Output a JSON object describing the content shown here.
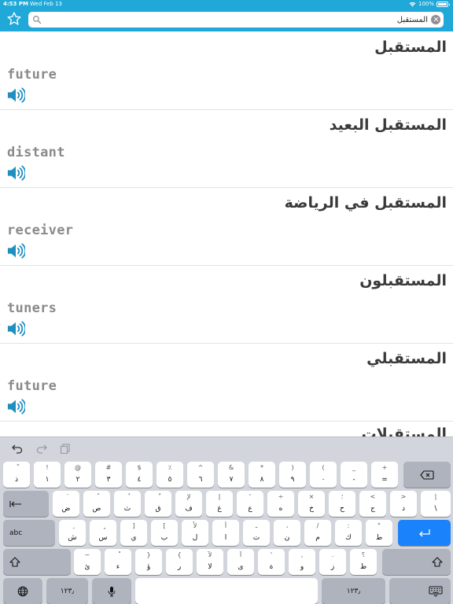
{
  "status": {
    "time": "4:53 PM",
    "date": "Wed Feb 13",
    "battery": "100%"
  },
  "search": {
    "query": "المستقبل",
    "placeholder": ""
  },
  "results": [
    {
      "arabic": "المستقبل",
      "english": "future"
    },
    {
      "arabic": "المستقبل البعيد",
      "english": "distant"
    },
    {
      "arabic": "المستقبل في الرياضة",
      "english": "receiver"
    },
    {
      "arabic": "المستقبلون",
      "english": "tuners"
    },
    {
      "arabic": "المستقبلي",
      "english": "future"
    },
    {
      "arabic": "المستقبلات",
      "english": ""
    }
  ],
  "keyboard": {
    "row1": [
      {
        "sub": "ّ",
        "main": "ذ"
      },
      {
        "sub": "!",
        "main": "١"
      },
      {
        "sub": "@",
        "main": "٢"
      },
      {
        "sub": "#",
        "main": "٣"
      },
      {
        "sub": "$",
        "main": "٤"
      },
      {
        "sub": "٪",
        "main": "٥"
      },
      {
        "sub": "^",
        "main": "٦"
      },
      {
        "sub": "&",
        "main": "٧"
      },
      {
        "sub": "*",
        "main": "٨"
      },
      {
        "sub": ")",
        "main": "٩"
      },
      {
        "sub": "(",
        "main": "٠"
      },
      {
        "sub": "_",
        "main": "-"
      },
      {
        "sub": "+",
        "main": "="
      }
    ],
    "row2": [
      {
        "sub": "َ",
        "main": "ض"
      },
      {
        "sub": "ً",
        "main": "ص"
      },
      {
        "sub": "ُ",
        "main": "ث"
      },
      {
        "sub": "ٌ",
        "main": "ق"
      },
      {
        "sub": "لإ",
        "main": "ف"
      },
      {
        "sub": "إ",
        "main": "غ"
      },
      {
        "sub": "‘",
        "main": "ع"
      },
      {
        "sub": "÷",
        "main": "ه"
      },
      {
        "sub": "×",
        "main": "خ"
      },
      {
        "sub": "؛",
        "main": "ح"
      },
      {
        "sub": "<",
        "main": "ج"
      },
      {
        "sub": ">",
        "main": "د"
      },
      {
        "sub": "|",
        "main": "\\"
      }
    ],
    "row3": [
      {
        "sub": "ِ",
        "main": "ش"
      },
      {
        "sub": "ٍ",
        "main": "س"
      },
      {
        "sub": "]",
        "main": "ي"
      },
      {
        "sub": "[",
        "main": "ب"
      },
      {
        "sub": "لأ",
        "main": "ل"
      },
      {
        "sub": "أ",
        "main": "ا"
      },
      {
        "sub": "ـ",
        "main": "ت"
      },
      {
        "sub": "،",
        "main": "ن"
      },
      {
        "sub": "/",
        "main": "م"
      },
      {
        "sub": ":",
        "main": "ك"
      },
      {
        "sub": "\"",
        "main": "ط"
      }
    ],
    "row4": [
      {
        "sub": "~",
        "main": "ئ"
      },
      {
        "sub": "ْ",
        "main": "ء"
      },
      {
        "sub": "}",
        "main": "ؤ"
      },
      {
        "sub": "{",
        "main": "ر"
      },
      {
        "sub": "لآ",
        "main": "لا"
      },
      {
        "sub": "آ",
        "main": "ى"
      },
      {
        "sub": "'",
        "main": "ة"
      },
      {
        "sub": ",",
        "main": "و"
      },
      {
        "sub": ".",
        "main": "ز"
      },
      {
        "sub": "؟",
        "main": "ظ"
      }
    ],
    "abc_label": "abc",
    "numbers_label": "١٢٣٫",
    "numbers_label_right": "١٢٣٫"
  }
}
